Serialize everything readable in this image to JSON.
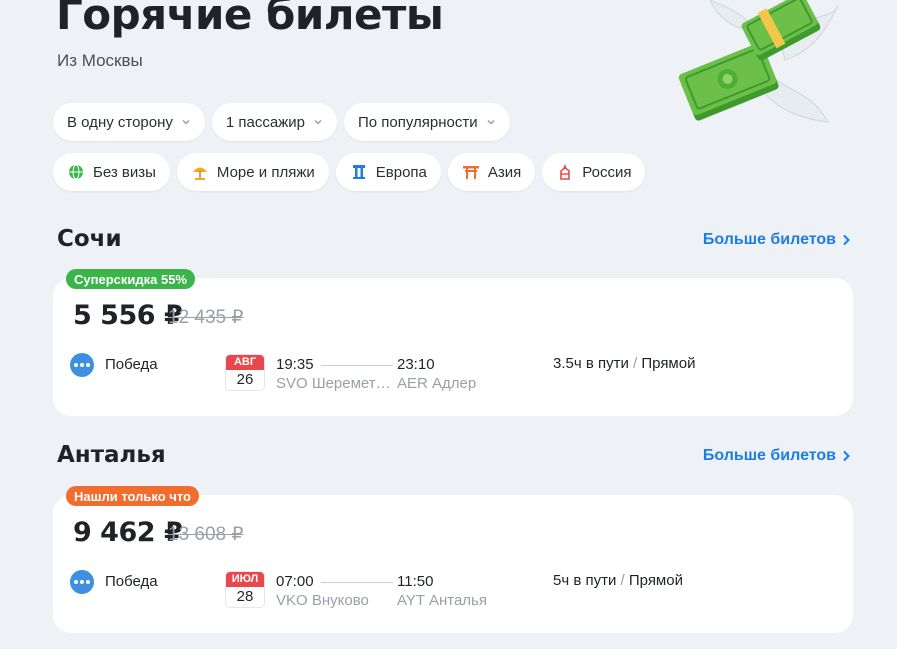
{
  "header": {
    "title": "Горячие билеты",
    "subtitle": "Из Москвы"
  },
  "filters": [
    {
      "label": "В одну сторону"
    },
    {
      "label": "1 пассажир"
    },
    {
      "label": "По популярности"
    }
  ],
  "categories": [
    {
      "label": "Без визы",
      "icon": "globe-icon",
      "color": "#3bb54a"
    },
    {
      "label": "Море и пляжи",
      "icon": "beach-umbrella-icon",
      "color": "#f5a623"
    },
    {
      "label": "Европа",
      "icon": "column-icon",
      "color": "#1c7de6"
    },
    {
      "label": "Азия",
      "icon": "torii-gate-icon",
      "color": "#f26c2d"
    },
    {
      "label": "Россия",
      "icon": "kremlin-icon",
      "color": "#e8474c"
    }
  ],
  "sections": [
    {
      "city": "Сочи",
      "more_label": "Больше билетов",
      "badge": "Суперскидка 55%",
      "badge_color": "#3bb54a",
      "price": "5 556 ₽",
      "old_price": "12 435 ₽",
      "airline": "Победа",
      "month": "АВГ",
      "day": "26",
      "dep_time": "19:35",
      "arr_time": "23:10",
      "dep_airport": "SVO Шереметьево",
      "arr_airport": "AER Адлер",
      "duration": "3.5ч в пути",
      "sep": "/",
      "stops": "Прямой"
    },
    {
      "city": "Анталья",
      "more_label": "Больше билетов",
      "badge": "Нашли только что",
      "badge_color": "#f26c2d",
      "price": "9 462 ₽",
      "old_price": "13 608 ₽",
      "airline": "Победа",
      "month": "ИЮЛ",
      "day": "28",
      "dep_time": "07:00",
      "arr_time": "11:50",
      "dep_airport": "VKO Внуково",
      "arr_airport": "AYT Анталья",
      "duration": "5ч в пути",
      "sep": "/",
      "stops": "Прямой"
    }
  ],
  "colors": {
    "background": "#eef1f5",
    "accent": "#1c7de6",
    "airline": "#3d8fe0",
    "date_month": "#e8474c"
  }
}
